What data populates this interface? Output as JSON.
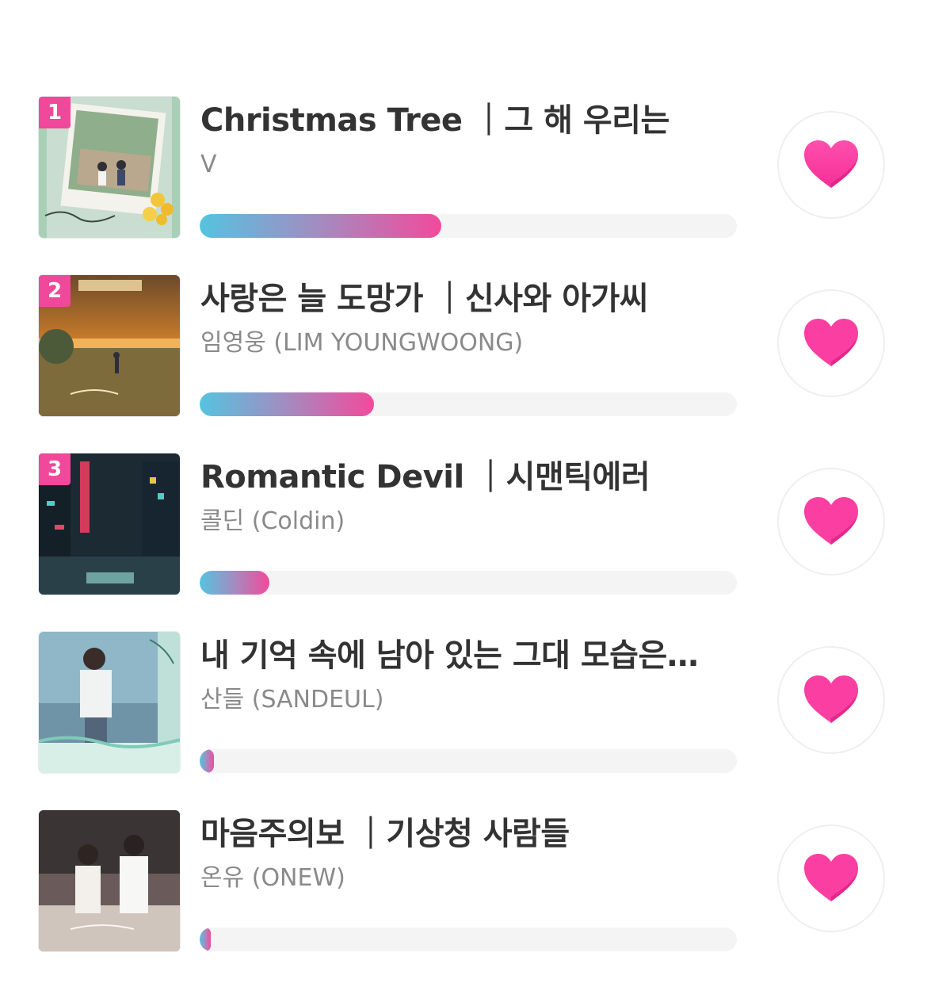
{
  "colors": {
    "accent": "#f0489a",
    "heart": "#ff3fa4",
    "bar_start": "#55c3e0",
    "bar_end": "#f24a9b",
    "track": "#f4f4f4"
  },
  "chart_rows": [
    {
      "rank": "1",
      "title": "Christmas Tree ｜그 해 우리는",
      "artist": "V",
      "vote_fraction": 0.45,
      "cover_icon": "album-cover-christmas-tree",
      "like_icon": "heart-icon"
    },
    {
      "rank": "2",
      "title": "사랑은 늘 도망가 ｜신사와 아가씨",
      "artist": "임영웅 (LIM YOUNGWOONG)",
      "vote_fraction": 0.325,
      "cover_icon": "album-cover-sunset",
      "like_icon": "heart-icon"
    },
    {
      "rank": "3",
      "title": "Romantic Devil ｜시맨틱에러",
      "artist": "콜딘 (Coldin)",
      "vote_fraction": 0.13,
      "cover_icon": "album-cover-night-city",
      "like_icon": "heart-icon"
    },
    {
      "rank": "",
      "title": "내 기억 속에 남아 있는 그대 모습은…",
      "artist": "산들 (SANDEUL)",
      "vote_fraction": 0.027,
      "cover_icon": "album-cover-seaside",
      "like_icon": "heart-icon"
    },
    {
      "rank": "",
      "title": "마음주의보 ｜기상청 사람들",
      "artist": "온유 (ONEW)",
      "vote_fraction": 0.02,
      "cover_icon": "album-cover-couple",
      "like_icon": "heart-icon"
    }
  ]
}
